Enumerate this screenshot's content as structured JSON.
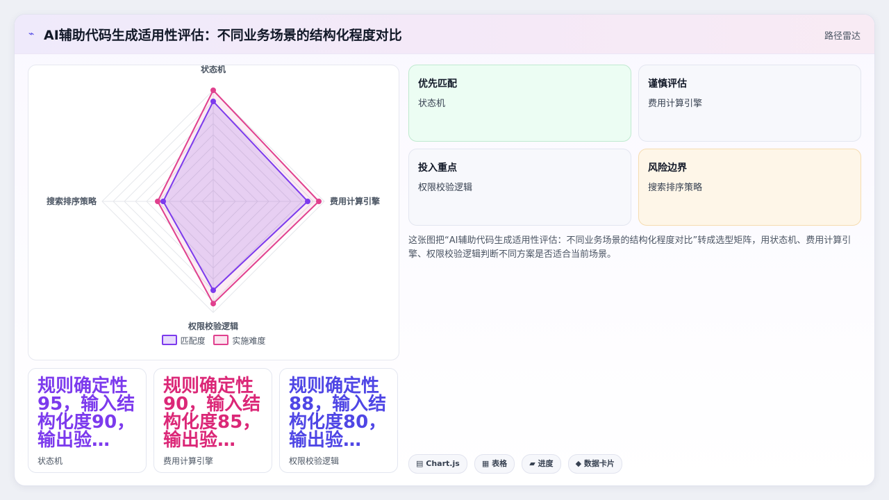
{
  "header": {
    "icon": "chart-line-icon",
    "title": "AI辅助代码生成适用性评估：不同业务场景的结构化程度对比",
    "route_label": "路径雷达"
  },
  "chart_data": {
    "type": "radar",
    "axes": [
      "状态机",
      "费用计算引擎",
      "权限校验逻辑",
      "搜索排序策略"
    ],
    "series": [
      {
        "name": "匹配度",
        "values": [
          90,
          85,
          80,
          45
        ],
        "color": "#7c3aed"
      },
      {
        "name": "实施难度",
        "values": [
          100,
          95,
          92,
          50
        ],
        "color": "#e0408e"
      }
    ],
    "rmax": 100,
    "grid": true,
    "legend": "bottom"
  },
  "stats": [
    {
      "value": "规则确定性95，输入结构化度90，输出验…",
      "label": "状态机",
      "color": "#7c3aed"
    },
    {
      "value": "规则确定性90，输入结构化度85，输出验…",
      "label": "费用计算引擎",
      "color": "#db2777"
    },
    {
      "value": "规则确定性88，输入结构化度80，输出验…",
      "label": "权限校验逻辑",
      "color": "#4f46e5"
    }
  ],
  "quadrants": [
    {
      "title": "优先匹配",
      "item": "状态机",
      "bg": "#ecfdf3",
      "border": "#bfe9cf"
    },
    {
      "title": "谨慎评估",
      "item": "费用计算引擎",
      "bg": "#f7f8fc",
      "border": "#e3e6f0"
    },
    {
      "title": "投入重点",
      "item": "权限校验逻辑",
      "bg": "#f7f8fc",
      "border": "#e3e6f0"
    },
    {
      "title": "风险边界",
      "item": "搜索排序策略",
      "bg": "#fef6e8",
      "border": "#f6dcb0"
    }
  ],
  "description": "这张图把“AI辅助代码生成适用性评估：不同业务场景的结构化程度对比”转成选型矩阵，用状态机、费用计算引擎、权限校验逻辑判断不同方案是否适合当前场景。",
  "tags": [
    {
      "icon": "chart-icon",
      "glyph": "▤",
      "label": "Chart.js"
    },
    {
      "icon": "table-icon",
      "glyph": "▦",
      "label": "表格"
    },
    {
      "icon": "progress-icon",
      "glyph": "▰",
      "label": "进度"
    },
    {
      "icon": "card-icon",
      "glyph": "◆",
      "label": "数据卡片"
    }
  ]
}
